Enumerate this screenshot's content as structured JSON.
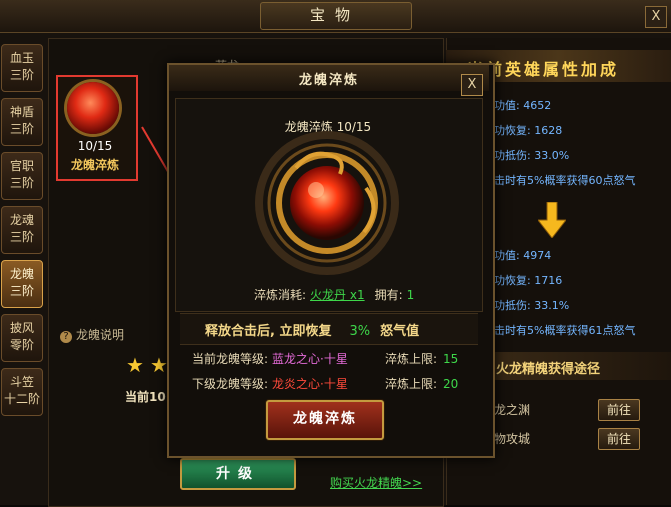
{
  "window": {
    "title": "宝物",
    "close": "X"
  },
  "tabs": [
    {
      "label": "血玉\n三阶",
      "active": false
    },
    {
      "label": "神盾\n三阶",
      "active": false
    },
    {
      "label": "官职\n三阶",
      "active": false
    },
    {
      "label": "龙魂\n三阶",
      "active": false
    },
    {
      "label": "龙魄\n三阶",
      "active": true
    },
    {
      "label": "披风\n零阶",
      "active": false
    },
    {
      "label": "斗笠\n十二阶",
      "active": false
    }
  ],
  "left": {
    "lan_label": "蓝龙",
    "item_count": "10/15",
    "item_name": "龙魄淬炼",
    "help_icon": "?",
    "help": "龙魄说明",
    "current_level": "当前10",
    "upgrade": "升级",
    "buy_link": "购买火龙精魄>>"
  },
  "right": {
    "title": "当前英雄属性加成",
    "current_stats": [
      "功值: 4652",
      "功恢复: 1628",
      "功抵伤: 33.0%",
      "击时有5%概率获得60点怒气"
    ],
    "next_stats": [
      "功值: 4974",
      "功恢复: 1716",
      "功抵伤: 33.1%",
      "击时有5%概率获得61点怒气"
    ],
    "route_title": "火龙精魄获得途径",
    "routes": [
      {
        "name": "龙之渊",
        "button": "前往"
      },
      {
        "name": "物攻城",
        "button": "前往"
      }
    ]
  },
  "modal": {
    "title": "龙魄淬炼",
    "close": "X",
    "temper_label": "龙魄淬炼 10/15",
    "cost_label": "淬炼消耗:",
    "cost_item": "火龙丹 x1",
    "own_label": "拥有:",
    "own_value": "1",
    "desc_prefix": "释放合击后, 立即恢复",
    "desc_pct": "3%",
    "desc_suffix": "怒气值",
    "current_level_label": "当前龙魄等级:",
    "current_level_name": "蓝龙之心·十星",
    "current_limit_label": "淬炼上限:",
    "current_limit": "15",
    "next_level_label": "下级龙魄等级:",
    "next_level_name": "龙炎之心·十星",
    "next_limit_label": "淬炼上限:",
    "next_limit": "20",
    "button": "龙魄淬炼"
  },
  "colors": {
    "accent_gold": "#f2c65c",
    "highlight_red": "#e23a30",
    "value_green": "#3ed64a",
    "stat_blue": "#74b6ff",
    "current_level_color": "#e46bd8",
    "next_level_color": "#ff4a3a"
  },
  "icons": {
    "star": "star-icon",
    "arrow_down": "arrow-down-icon",
    "help": "question-icon",
    "orb": "dragon-orb-icon"
  }
}
